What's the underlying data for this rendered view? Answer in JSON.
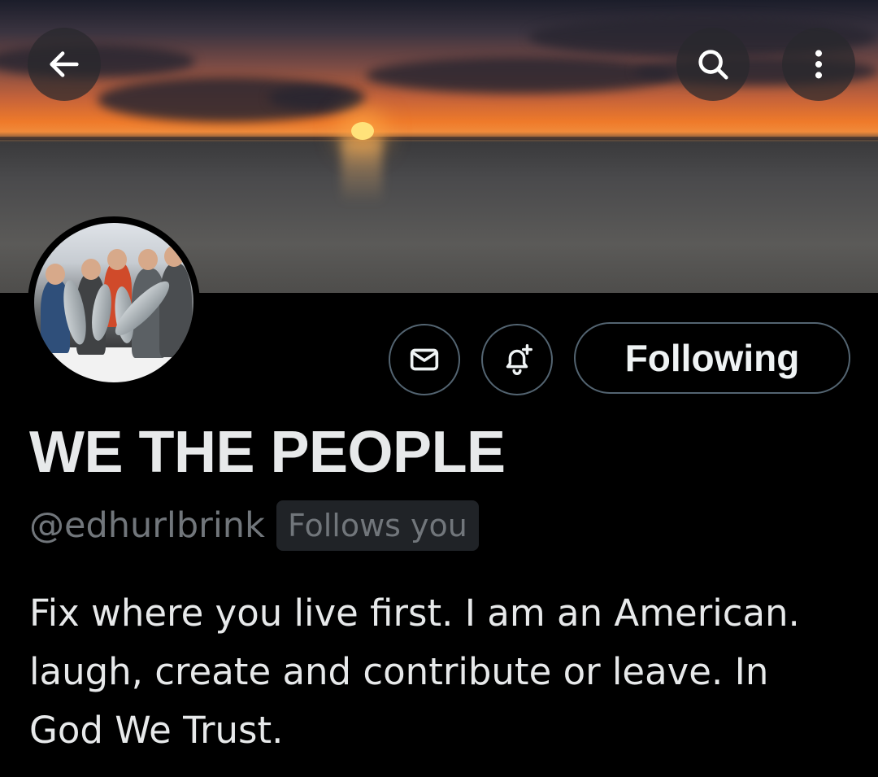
{
  "profile": {
    "display_name": "WE THE PEOPLE",
    "handle": "@edhurlbrink",
    "follows_you_badge": "Follows you",
    "bio": "Fix where you live first. I am an American. laugh, create and contribute or leave. In God We Trust."
  },
  "actions": {
    "follow_state_label": "Following",
    "message_icon": "envelope-icon",
    "notify_icon": "bell-plus-icon"
  },
  "header": {
    "back_icon": "arrow-left-icon",
    "search_icon": "search-icon",
    "more_icon": "more-vertical-icon"
  },
  "colors": {
    "background": "#000000",
    "text_primary": "#e7e9ea",
    "text_secondary": "#71767b",
    "button_border": "#536471",
    "badge_bg": "#202327"
  }
}
